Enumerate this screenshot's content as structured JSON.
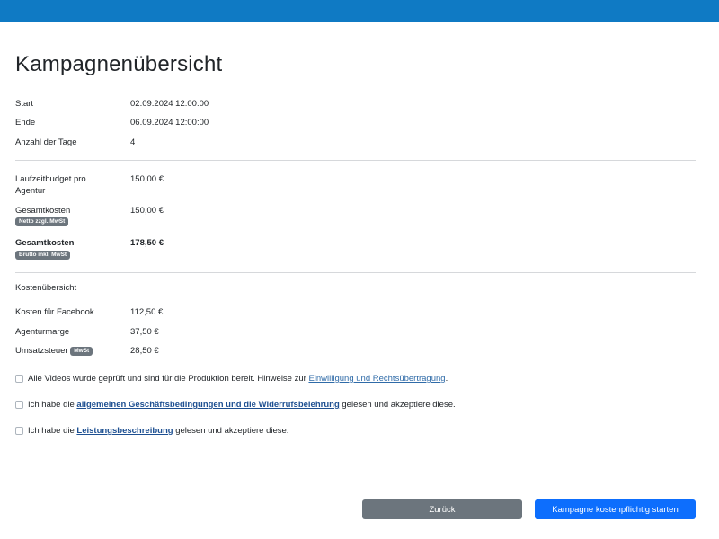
{
  "page_title": "Kampagnenübersicht",
  "dates": {
    "start_label": "Start",
    "start_value": "02.09.2024 12:00:00",
    "end_label": "Ende",
    "end_value": "06.09.2024 12:00:00",
    "days_label": "Anzahl der Tage",
    "days_value": "4"
  },
  "budget": {
    "budget_label": "Laufzeitbudget pro Agentur",
    "budget_value": "150,00 €",
    "net_label": "Gesamtkosten",
    "net_badge": "Netto zzgl. MwSt",
    "net_value": "150,00 €",
    "gross_label": "Gesamtkosten",
    "gross_badge": "Brutto inkl. MwSt",
    "gross_value": "178,50 €"
  },
  "overview": {
    "section_label": "Kostenübersicht",
    "facebook_label": "Kosten für Facebook",
    "facebook_value": "112,50 €",
    "margin_label": "Agenturmarge",
    "margin_value": "37,50 €",
    "tax_label": "Umsatzsteuer",
    "tax_badge": "MwSt",
    "tax_value": "28,50 €"
  },
  "consents": [
    {
      "text_before": "Alle Videos wurde geprüft und sind für die Produktion bereit. Hinweise zur ",
      "link": "Einwilligung und Rechtsübertragung",
      "text_after": ".",
      "checked": false
    },
    {
      "text_before": "Ich habe die ",
      "link": "allgemeinen Geschäftsbedingungen und die Widerrufsbelehrung",
      "text_after": " gelesen und akzeptiere diese.",
      "checked": false
    },
    {
      "text_before": "Ich habe die ",
      "link": "Leistungsbeschreibung",
      "text_after": " gelesen und akzeptiere diese.",
      "checked": false
    }
  ],
  "buttons": {
    "back_label": "Zurück",
    "start_label": "Kampagne kostenpflichtig starten"
  },
  "colors": {
    "topbar": "#0f7ac4",
    "primary_button": "#0d6efd",
    "secondary_button": "#6c757d",
    "badge": "#6c757d",
    "link": "#2f6ba8"
  }
}
